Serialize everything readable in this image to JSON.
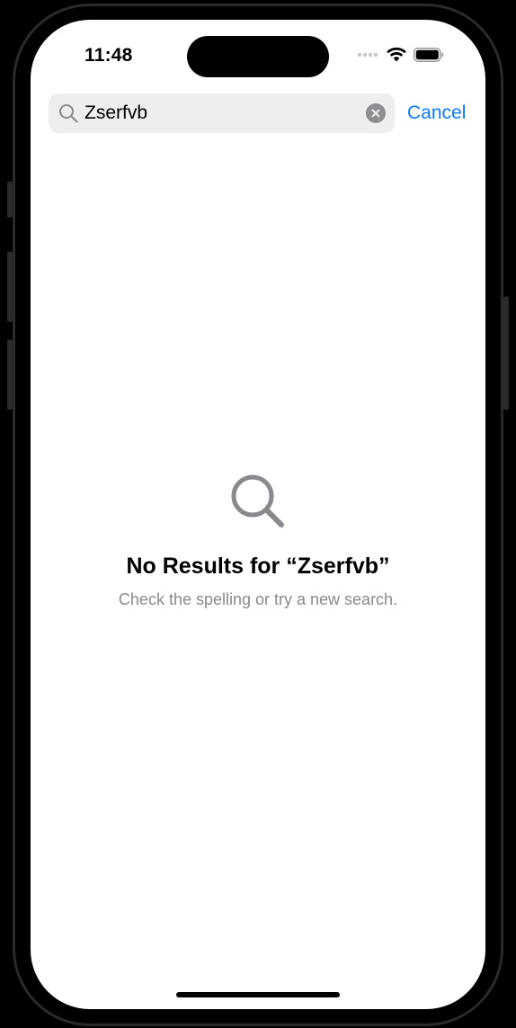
{
  "status_bar": {
    "time": "11:48",
    "signal_icon": "cellular-signal-icon",
    "wifi_icon": "wifi-icon",
    "battery_icon": "battery-icon"
  },
  "search": {
    "icon": "search-icon",
    "query": "Zserfvb",
    "clear_icon": "clear-icon",
    "cancel_label": "Cancel"
  },
  "empty_state": {
    "icon": "search-icon",
    "title": "No Results for “Zserfvb”",
    "subtitle": "Check the spelling or try a new search."
  },
  "colors": {
    "accent": "#0a7aff",
    "search_field_bg": "#eeeeef",
    "secondary_text": "#8a8a8e"
  }
}
